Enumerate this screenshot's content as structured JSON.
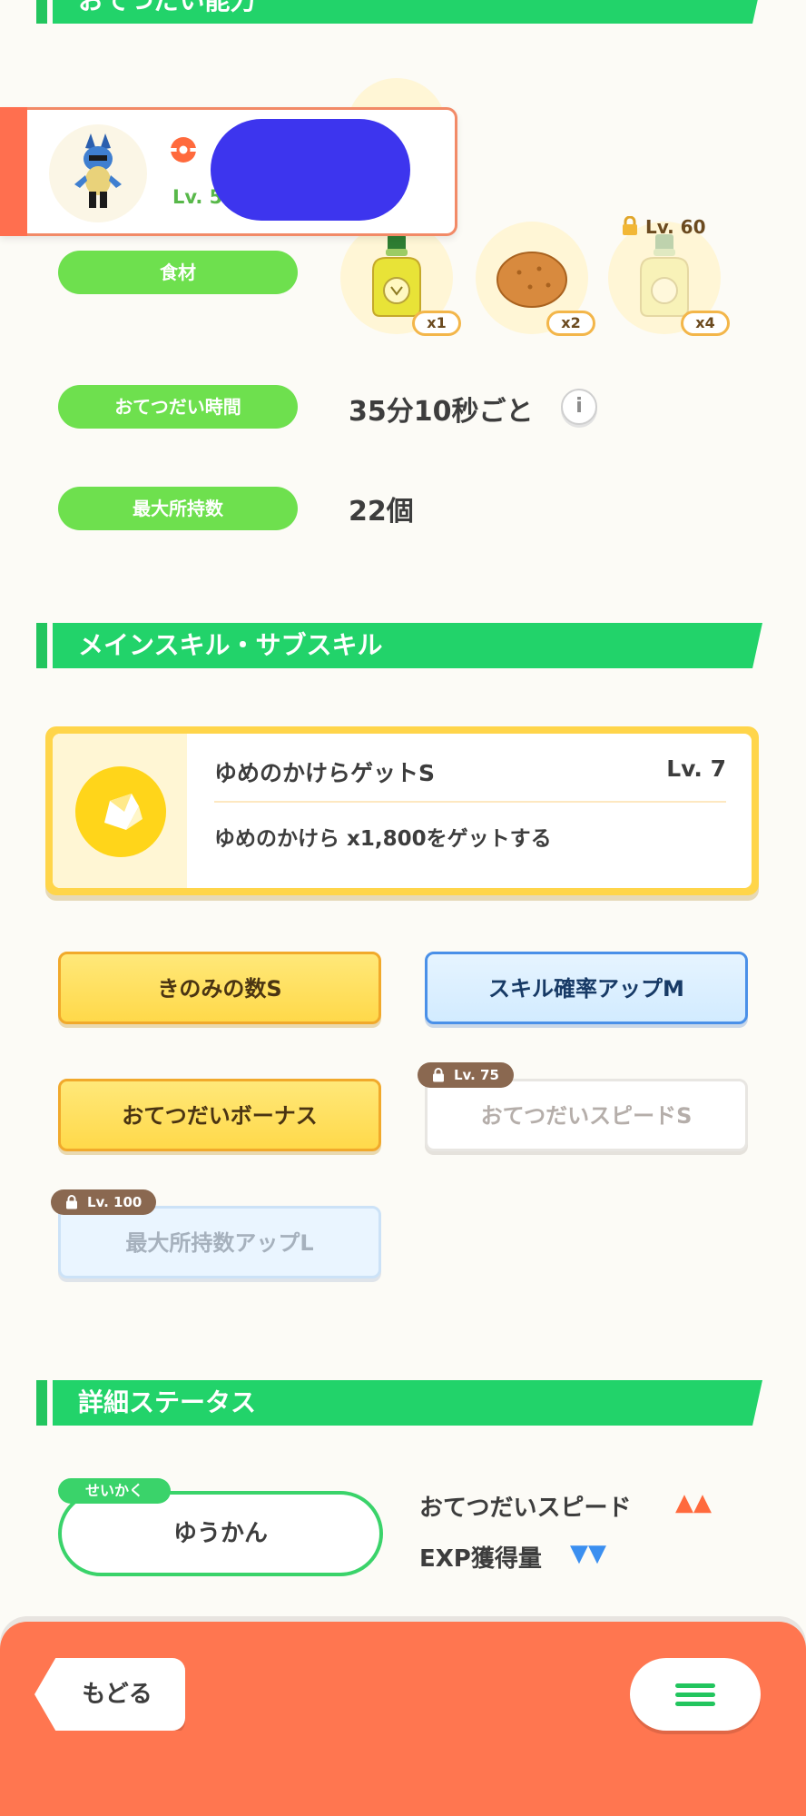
{
  "sections": {
    "helper": "おてつだい能力",
    "skills": "メインスキル・サブスキル",
    "details": "詳細ステータス"
  },
  "pokemon_card": {
    "level_text": "Lv. 5"
  },
  "ingredients": {
    "label": "食材",
    "items": [
      {
        "name": "oil-bottle",
        "count": "x1",
        "locked": false
      },
      {
        "name": "potato",
        "count": "x2",
        "locked": false
      },
      {
        "name": "oil-bottle",
        "count": "x4",
        "locked": true,
        "lock_level": "Lv. 60"
      }
    ]
  },
  "help_time": {
    "label": "おてつだい時間",
    "value": "35分10秒ごと"
  },
  "max_carry": {
    "label": "最大所持数",
    "value": "22個"
  },
  "main_skill": {
    "name": "ゆめのかけらゲットS",
    "level": "Lv. 7",
    "description": "ゆめのかけら x1,800をゲットする"
  },
  "sub_skills": [
    {
      "label": "きのみの数S",
      "style": "gold",
      "locked": false
    },
    {
      "label": "スキル確率アップM",
      "style": "blue",
      "locked": false
    },
    {
      "label": "おてつだいボーナス",
      "style": "gold",
      "locked": false
    },
    {
      "label": "おてつだいスピードS",
      "style": "locked-white",
      "locked": true,
      "lock_level": "Lv. 75"
    },
    {
      "label": "最大所持数アップL",
      "style": "locked-blue",
      "locked": true,
      "lock_level": "Lv. 100"
    }
  ],
  "nature": {
    "tag": "せいかく",
    "value": "ゆうかん",
    "effects": [
      {
        "label": "おてつだいスピード",
        "direction": "up",
        "symbol": "▲▲",
        "color": "#ff6a3d"
      },
      {
        "label": "EXP獲得量",
        "direction": "down",
        "symbol": "▼▼",
        "color": "#3b8ff0"
      }
    ]
  },
  "nav": {
    "back_label": "もどる"
  },
  "colors": {
    "green": "#22d36a",
    "pill_green": "#6ee04e",
    "orange": "#ff7650",
    "gold": "#ffd54a"
  }
}
